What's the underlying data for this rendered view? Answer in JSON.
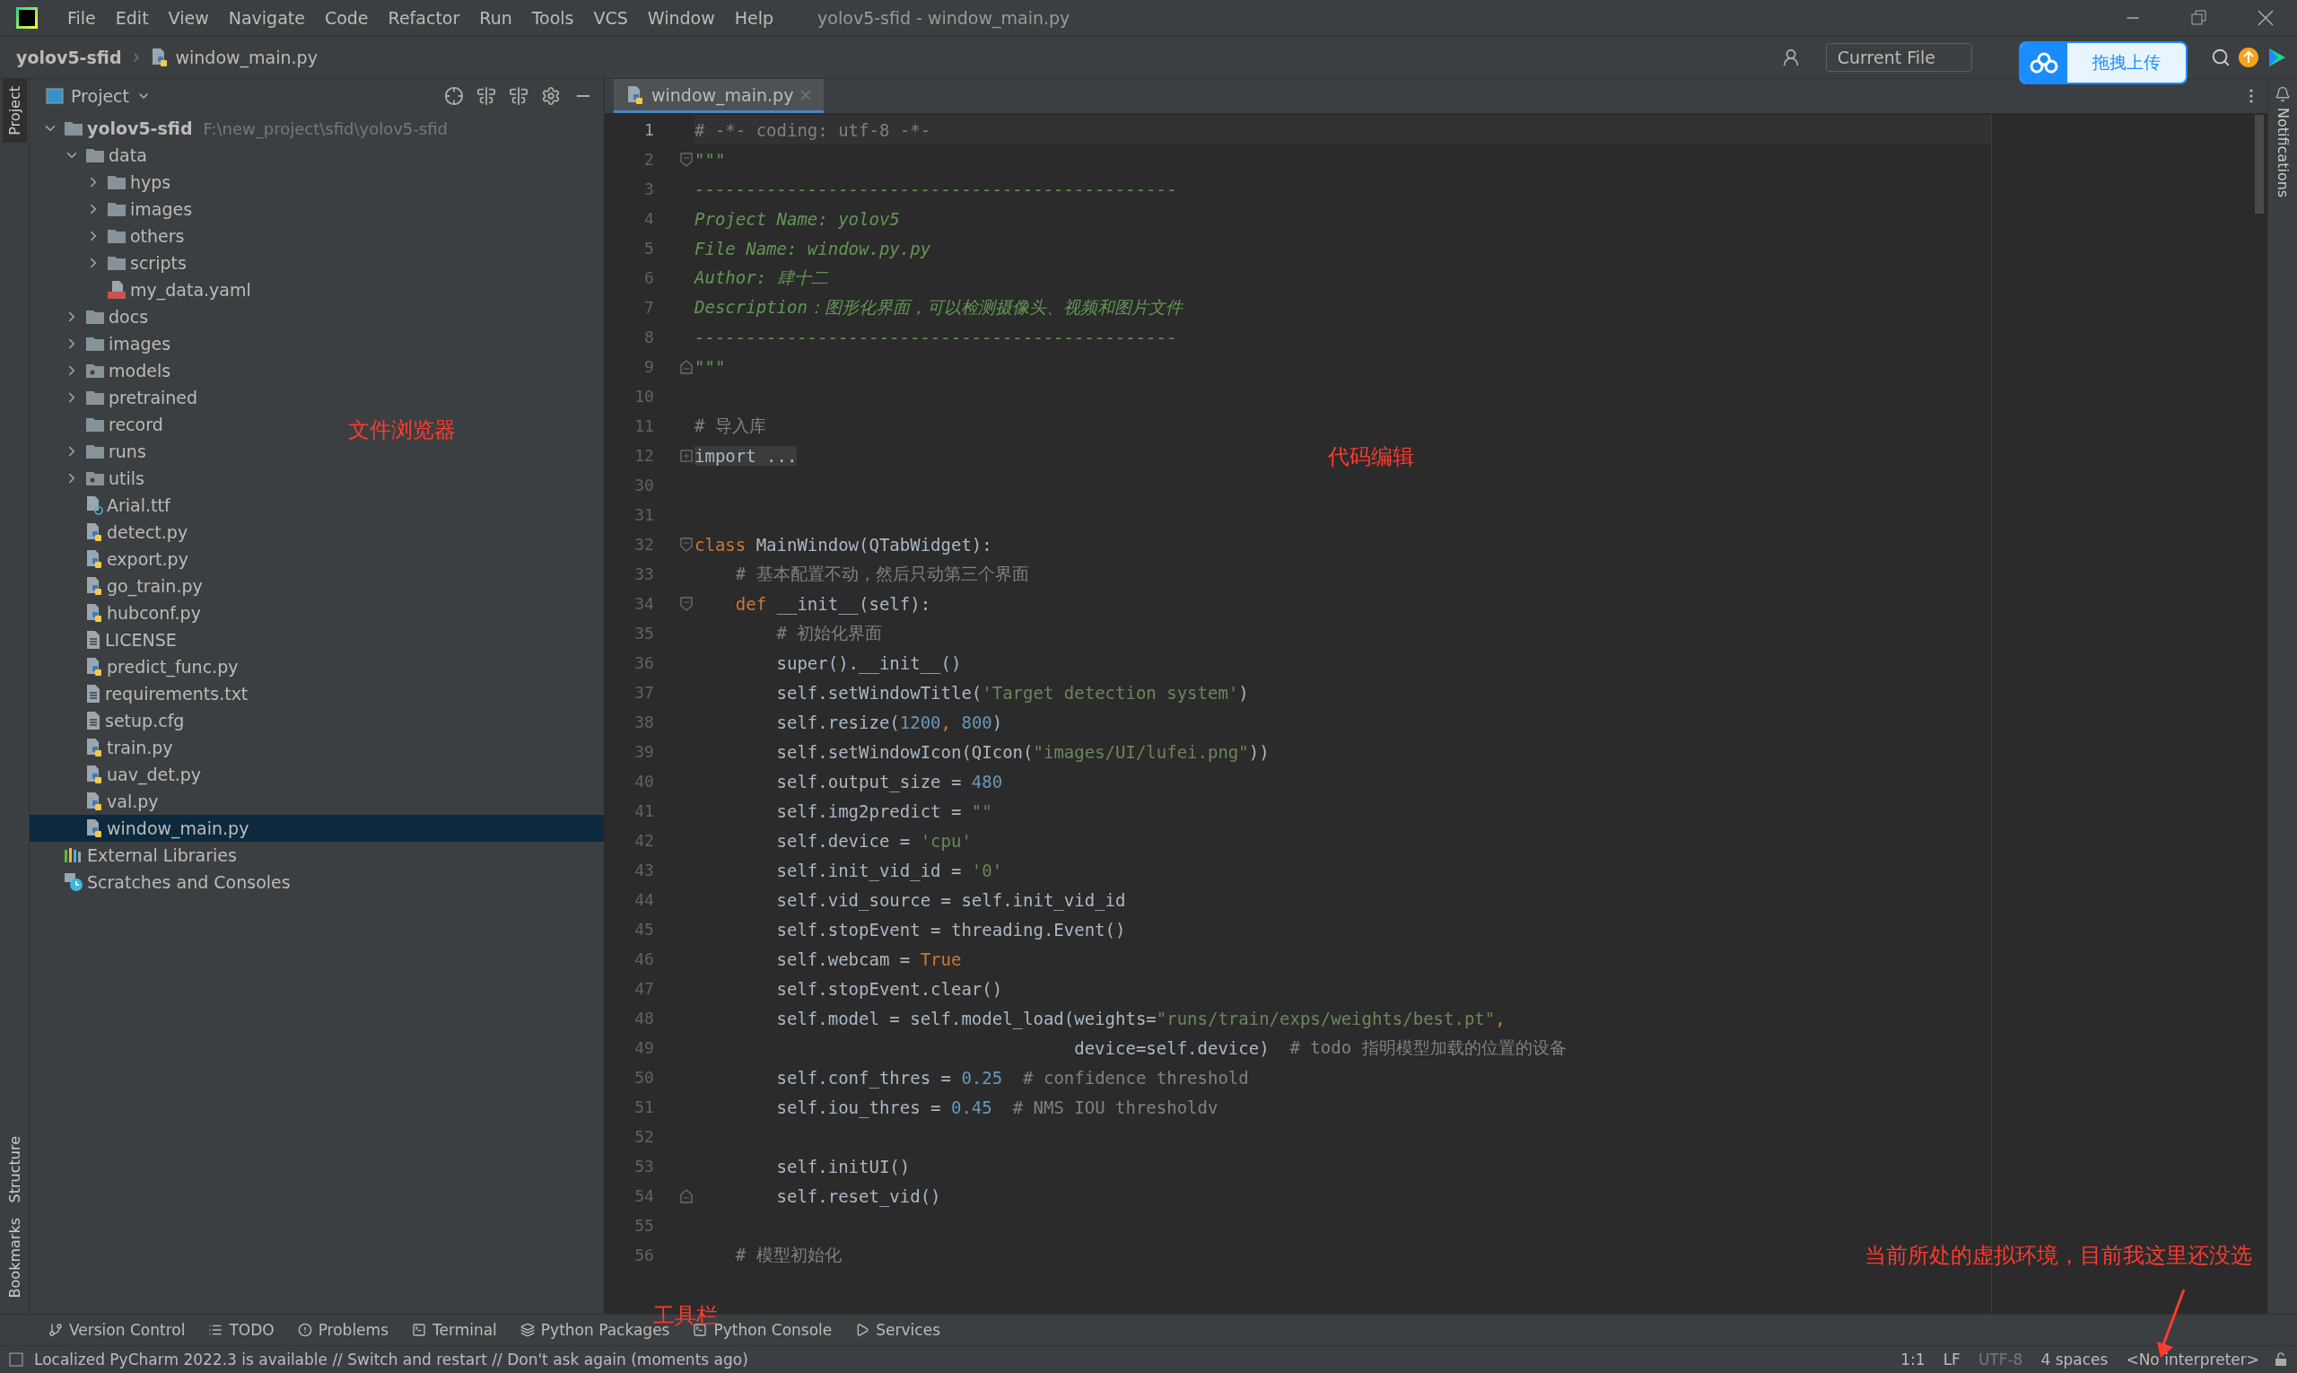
{
  "menu": [
    "File",
    "Edit",
    "View",
    "Navigate",
    "Code",
    "Refactor",
    "Run",
    "Tools",
    "VCS",
    "Window",
    "Help"
  ],
  "window": {
    "title": "yolov5-sfid - window_main.py"
  },
  "breadcrumbs": [
    "yolov5-sfid",
    "window_main.py"
  ],
  "toolbar": {
    "run_config": "Current File"
  },
  "upload_widget": {
    "label": "拖拽上传"
  },
  "left_stripe": [
    {
      "label": "Project",
      "selected": true
    },
    {
      "label": "Structure",
      "selected": false
    },
    {
      "label": "Bookmarks",
      "selected": false
    }
  ],
  "right_stripe": [
    {
      "label": "Notifications"
    }
  ],
  "project_panel": {
    "title": "Project",
    "tree": [
      {
        "name": "yolov5-sfid",
        "path": "F:\\new_project\\sfid\\yolov5-sfid",
        "kind": "folder",
        "expanded": true,
        "selected": false,
        "children": [
          {
            "name": "data",
            "kind": "folder",
            "expanded": true,
            "selected": false,
            "children": [
              {
                "name": "hyps",
                "kind": "folder",
                "expanded": false,
                "selected": false
              },
              {
                "name": "images",
                "kind": "folder",
                "expanded": false,
                "selected": false
              },
              {
                "name": "others",
                "kind": "folder",
                "expanded": false,
                "selected": false
              },
              {
                "name": "scripts",
                "kind": "folder",
                "expanded": false,
                "selected": false
              },
              {
                "name": "my_data.yaml",
                "kind": "yaml",
                "selected": false
              }
            ]
          },
          {
            "name": "docs",
            "kind": "folder",
            "expanded": false,
            "selected": false
          },
          {
            "name": "images",
            "kind": "folder",
            "expanded": false,
            "selected": false
          },
          {
            "name": "models",
            "kind": "package",
            "expanded": false,
            "selected": false
          },
          {
            "name": "pretrained",
            "kind": "folder",
            "expanded": false,
            "selected": false
          },
          {
            "name": "record",
            "kind": "folder",
            "selected": false
          },
          {
            "name": "runs",
            "kind": "folder",
            "expanded": false,
            "selected": false
          },
          {
            "name": "utils",
            "kind": "package",
            "expanded": false,
            "selected": false
          },
          {
            "name": "Arial.ttf",
            "kind": "unknown",
            "selected": false
          },
          {
            "name": "detect.py",
            "kind": "python",
            "selected": false
          },
          {
            "name": "export.py",
            "kind": "python",
            "selected": false
          },
          {
            "name": "go_train.py",
            "kind": "python",
            "selected": false
          },
          {
            "name": "hubconf.py",
            "kind": "python",
            "selected": false
          },
          {
            "name": "LICENSE",
            "kind": "text",
            "selected": false
          },
          {
            "name": "predict_func.py",
            "kind": "python",
            "selected": false
          },
          {
            "name": "requirements.txt",
            "kind": "text",
            "selected": false
          },
          {
            "name": "setup.cfg",
            "kind": "text",
            "selected": false
          },
          {
            "name": "train.py",
            "kind": "python",
            "selected": false
          },
          {
            "name": "uav_det.py",
            "kind": "python",
            "selected": false
          },
          {
            "name": "val.py",
            "kind": "python",
            "selected": false
          },
          {
            "name": "window_main.py",
            "kind": "python",
            "selected": true
          }
        ]
      },
      {
        "name": "External Libraries",
        "kind": "libraries",
        "selected": false
      },
      {
        "name": "Scratches and Consoles",
        "kind": "scratches",
        "selected": false
      }
    ]
  },
  "editor": {
    "tabs": [
      {
        "label": "window_main.py",
        "selected": true
      }
    ],
    "lines": [
      {
        "number": "1",
        "kind": "plain",
        "tokens": [
          {
            "kind": "comment",
            "text": "# -*- coding: utf-8 -*-"
          }
        ]
      },
      {
        "number": "2",
        "kind": "fold_open",
        "tokens": [
          {
            "kind": "doc",
            "text": "\"\"\""
          }
        ]
      },
      {
        "number": "3",
        "tokens": [
          {
            "kind": "doc",
            "text": "-----------------------------------------------"
          }
        ]
      },
      {
        "number": "4",
        "tokens": [
          {
            "kind": "doc",
            "text": "Project Name: yolov5"
          }
        ]
      },
      {
        "number": "5",
        "tokens": [
          {
            "kind": "doc",
            "text": "File Name: window.py.py"
          }
        ]
      },
      {
        "number": "6",
        "tokens": [
          {
            "kind": "doc",
            "text": "Author: 肆十二"
          }
        ]
      },
      {
        "number": "7",
        "tokens": [
          {
            "kind": "doc",
            "text": "Description：图形化界面，可以检测摄像头、视频和图片文件"
          }
        ]
      },
      {
        "number": "8",
        "tokens": [
          {
            "kind": "doc",
            "text": "-----------------------------------------------"
          }
        ]
      },
      {
        "number": "9",
        "kind": "fold_close",
        "tokens": [
          {
            "kind": "doc",
            "text": "\"\"\""
          }
        ]
      },
      {
        "number": "10",
        "kind": "plain"
      },
      {
        "number": "11",
        "tokens": [
          {
            "kind": "comment",
            "text": "# 导入库"
          }
        ]
      },
      {
        "number": "12",
        "kind": "folded",
        "tokens": [
          {
            "kind": "folded",
            "text": "import ..."
          }
        ]
      },
      {
        "number": "30",
        "kind": "plain"
      },
      {
        "number": "31",
        "kind": "plain"
      },
      {
        "number": "32",
        "kind": "fold_open",
        "tokens": [
          {
            "kind": "keyword",
            "text": "class "
          },
          {
            "kind": "plain",
            "text": "MainWindow(QTabWidget):"
          }
        ]
      },
      {
        "number": "33",
        "tokens": [
          {
            "kind": "comment",
            "text": "    # 基本配置不动，然后只动第三个界面"
          }
        ]
      },
      {
        "number": "34",
        "kind": "fold_open",
        "tokens": [
          {
            "kind": "keyword",
            "text": "    def "
          },
          {
            "kind": "plain",
            "text": "__init__(self):"
          }
        ]
      },
      {
        "number": "35",
        "tokens": [
          {
            "kind": "comment",
            "text": "        # 初始化界面"
          }
        ]
      },
      {
        "number": "36",
        "tokens": [
          {
            "kind": "plain",
            "text": "        super().__init__()"
          }
        ]
      },
      {
        "number": "37",
        "tokens": [
          {
            "kind": "plain",
            "text": "        self.setWindowTitle("
          },
          {
            "kind": "string",
            "text": "'Target detection system'"
          },
          {
            "kind": "plain",
            "text": ")"
          }
        ]
      },
      {
        "number": "38",
        "tokens": [
          {
            "kind": "plain",
            "text": "        self.resize("
          },
          {
            "kind": "number",
            "text": "1200"
          },
          {
            "kind": "keyword",
            "text": ", "
          },
          {
            "kind": "number",
            "text": "800"
          },
          {
            "kind": "plain",
            "text": ")"
          }
        ]
      },
      {
        "number": "39",
        "tokens": [
          {
            "kind": "plain",
            "text": "        self.setWindowIcon(QIcon("
          },
          {
            "kind": "string",
            "text": "\"images/UI/lufei.png\""
          },
          {
            "kind": "plain",
            "text": "))"
          }
        ]
      },
      {
        "number": "40",
        "tokens": [
          {
            "kind": "plain",
            "text": "        self.output_size = "
          },
          {
            "kind": "number",
            "text": "480"
          }
        ]
      },
      {
        "number": "41",
        "tokens": [
          {
            "kind": "plain",
            "text": "        self.img2predict = "
          },
          {
            "kind": "string",
            "text": "\"\""
          }
        ]
      },
      {
        "number": "42",
        "tokens": [
          {
            "kind": "plain",
            "text": "        self.device = "
          },
          {
            "kind": "string",
            "text": "'cpu'"
          }
        ]
      },
      {
        "number": "43",
        "tokens": [
          {
            "kind": "plain",
            "text": "        self.init_vid_id = "
          },
          {
            "kind": "string",
            "text": "'0'"
          }
        ]
      },
      {
        "number": "44",
        "tokens": [
          {
            "kind": "plain",
            "text": "        self.vid_source = self.init_vid_id"
          }
        ]
      },
      {
        "number": "45",
        "tokens": [
          {
            "kind": "plain",
            "text": "        self.stopEvent = threading.Event()"
          }
        ]
      },
      {
        "number": "46",
        "tokens": [
          {
            "kind": "plain",
            "text": "        self.webcam = "
          },
          {
            "kind": "keyword",
            "text": "True"
          }
        ]
      },
      {
        "number": "47",
        "tokens": [
          {
            "kind": "plain",
            "text": "        self.stopEvent.clear()"
          }
        ]
      },
      {
        "number": "48",
        "tokens": [
          {
            "kind": "plain",
            "text": "        self.model = self.model_load(weights="
          },
          {
            "kind": "string",
            "text": "\"runs/train/exps/weights/best.pt\""
          },
          {
            "kind": "keyword",
            "text": ","
          }
        ]
      },
      {
        "number": "49",
        "tokens": [
          {
            "kind": "plain",
            "text": "                                     device=self.device)  "
          },
          {
            "kind": "comment",
            "text": "# todo 指明模型加载的位置的设备"
          }
        ]
      },
      {
        "number": "50",
        "tokens": [
          {
            "kind": "plain",
            "text": "        self.conf_thres = "
          },
          {
            "kind": "number",
            "text": "0.25"
          },
          {
            "kind": "comment",
            "text": "  # confidence threshold"
          }
        ]
      },
      {
        "number": "51",
        "tokens": [
          {
            "kind": "plain",
            "text": "        self.iou_thres = "
          },
          {
            "kind": "number",
            "text": "0.45"
          },
          {
            "kind": "comment",
            "text": "  # NMS IOU thresholdv"
          }
        ]
      },
      {
        "number": "52",
        "kind": "plain"
      },
      {
        "number": "53",
        "tokens": [
          {
            "kind": "plain",
            "text": "        self.initUI()"
          }
        ]
      },
      {
        "number": "54",
        "kind": "fold_close",
        "tokens": [
          {
            "kind": "plain",
            "text": "        self.reset_vid()"
          }
        ]
      },
      {
        "number": "55",
        "kind": "plain"
      },
      {
        "number": "56",
        "tokens": [
          {
            "kind": "comment",
            "text": "    # 模型初始化"
          }
        ]
      }
    ]
  },
  "annotations": [
    {
      "text": "文件浏览器",
      "kind": "tree"
    },
    {
      "text": "代码编辑",
      "kind": "editor"
    },
    {
      "text": "工具栏",
      "kind": "toolbar"
    },
    {
      "text": "当前所处的虚拟环境，目前我这里还没选",
      "kind": "interpreter"
    }
  ],
  "tool_tabs": [
    {
      "label": "Version Control",
      "kind": "vcs"
    },
    {
      "label": "TODO",
      "kind": "todo"
    },
    {
      "label": "Problems",
      "kind": "problems"
    },
    {
      "label": "Terminal",
      "kind": "terminal"
    },
    {
      "label": "Python Packages",
      "kind": "packages"
    },
    {
      "label": "Python Console",
      "kind": "console"
    },
    {
      "label": "Services",
      "kind": "services"
    }
  ],
  "status_bar": {
    "message": "Localized PyCharm 2022.3 is available // Switch and restart // Don't ask again (moments ago)",
    "items": [
      "1:1",
      "LF",
      "UTF-8",
      "4 spaces",
      "<No interpreter>"
    ]
  }
}
